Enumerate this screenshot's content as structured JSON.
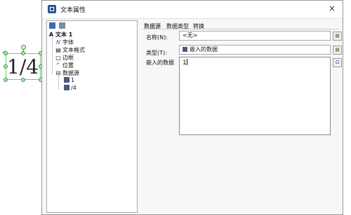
{
  "canvas": {
    "object_text": "1/4"
  },
  "dialog": {
    "title": "文本属性",
    "close_glyph": "×"
  },
  "tree": {
    "root_label": "文本 1",
    "items": [
      {
        "label": "字体"
      },
      {
        "label": "文本格式"
      },
      {
        "label": "边框"
      },
      {
        "label": "位置"
      },
      {
        "label": "数据源"
      }
    ],
    "datasource_children": [
      {
        "label": "1"
      },
      {
        "label": "/4"
      }
    ]
  },
  "tabs": [
    {
      "label": "数据源"
    },
    {
      "label": "数据类型"
    },
    {
      "label": "转换"
    }
  ],
  "form": {
    "name_label": "名称(N):",
    "name_value": "<无>",
    "type_label": "类型(T):",
    "type_value": "嵌入的数据",
    "embedded_label": "嵌入的数据",
    "embedded_value": "1"
  },
  "colors": {
    "selection_green": "#2e9e2e",
    "app_icon_blue": "#2b5797"
  }
}
